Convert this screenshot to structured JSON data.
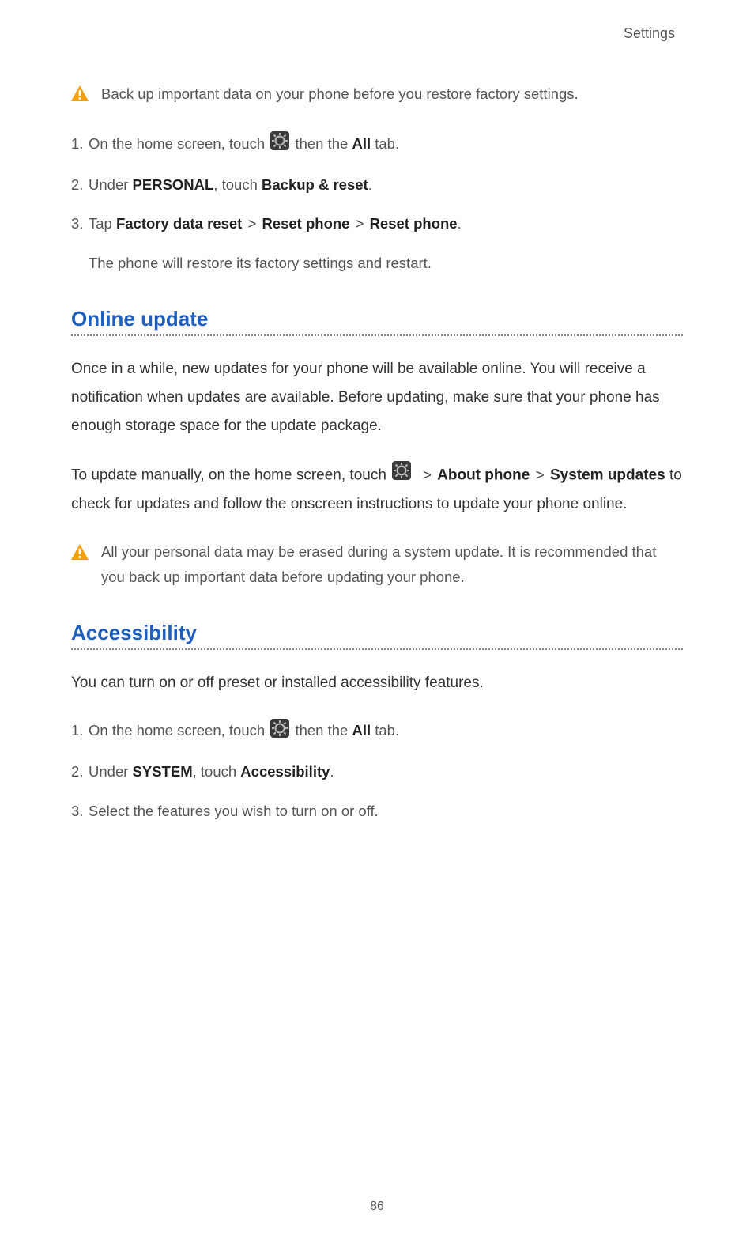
{
  "header": "Settings",
  "warning1": "Back up important data on your phone before you restore factory settings.",
  "steps_a": {
    "s1_pre": "On the home screen, touch ",
    "s1_post": " then the ",
    "s1_bold_all": "All",
    "s1_tail": " tab.",
    "s2_pre": "Under ",
    "s2_bold_personal": "PERSONAL",
    "s2_mid": ", touch ",
    "s2_bold_backup": "Backup & reset",
    "s2_tail": ".",
    "s3_pre": "Tap ",
    "s3_b1": "Factory data reset",
    "s3_b2": "Reset phone",
    "s3_b3": "Reset phone",
    "s3_tail": ".",
    "s3_follow": "The phone will restore its factory settings and restart."
  },
  "heading_online": "Online update",
  "online_p1": "Once in a while, new updates for your phone will be available online. You will receive a notification when updates are available. Before updating, make sure that your phone has enough storage space for the update package.",
  "online_p2_pre": "To update manually, on the home screen, touch ",
  "online_p2_b1": "About phone",
  "online_p2_b2": "System updates",
  "online_p2_post": " to check for updates and follow the onscreen instructions to update your phone online.",
  "warning2": "All your personal data may be erased during a system update. It is recommended that you back up important data before updating your phone.",
  "heading_access": "Accessibility",
  "access_p1": "You can turn on or off preset or installed accessibility features.",
  "steps_b": {
    "s1_pre": "On the home screen, touch ",
    "s1_post": " then the ",
    "s1_bold_all": "All",
    "s1_tail": " tab.",
    "s2_pre": "Under ",
    "s2_bold_system": "SYSTEM",
    "s2_mid": ", touch ",
    "s2_bold_access": "Accessibility",
    "s2_tail": ".",
    "s3": "Select the features you wish to turn on or off."
  },
  "page_number": "86",
  "gt": ">"
}
